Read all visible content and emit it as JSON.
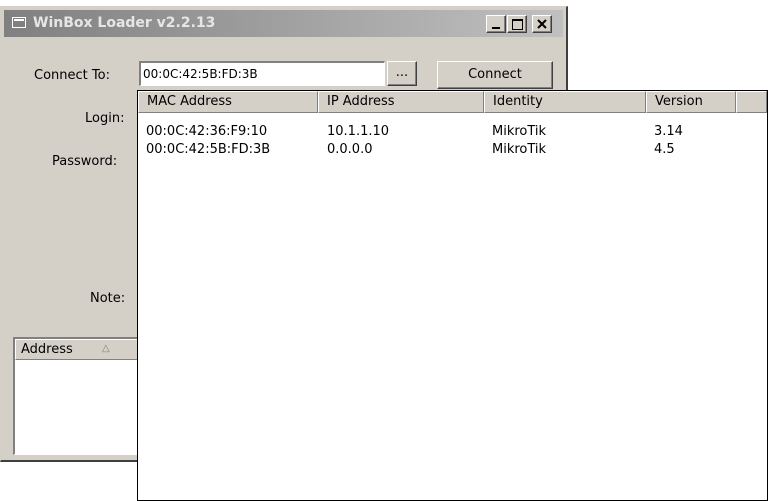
{
  "window": {
    "title": "WinBox Loader v2.2.13",
    "controls": {
      "minimize": "minimize",
      "maximize": "maximize",
      "close": "close"
    }
  },
  "form": {
    "connect_to_label": "Connect To:",
    "connect_to_value": "00:0C:42:5B:FD:3B",
    "browse_label": "...",
    "connect_label": "Connect",
    "login_label": "Login:",
    "password_label": "Password:",
    "note_label": "Note:"
  },
  "address_list": {
    "column": "Address",
    "sort_indicator": "△"
  },
  "neighbors": {
    "columns": [
      "MAC Address",
      "IP Address",
      "Identity",
      "Version"
    ],
    "rows": [
      {
        "mac": "00:0C:42:36:F9:10",
        "ip": "10.1.1.10",
        "identity": "MikroTik",
        "version": "3.14"
      },
      {
        "mac": "00:0C:42:5B:FD:3B",
        "ip": "0.0.0.0",
        "identity": "MikroTik",
        "version": "4.5"
      }
    ]
  },
  "colors": {
    "window_face": "#d4d0c8",
    "inactive_title_start": "#808080",
    "inactive_title_end": "#c0c0c0"
  },
  "icons": [
    "app-window-icon",
    "minimize-icon",
    "maximize-icon",
    "close-icon",
    "sort-ascending-icon"
  ]
}
